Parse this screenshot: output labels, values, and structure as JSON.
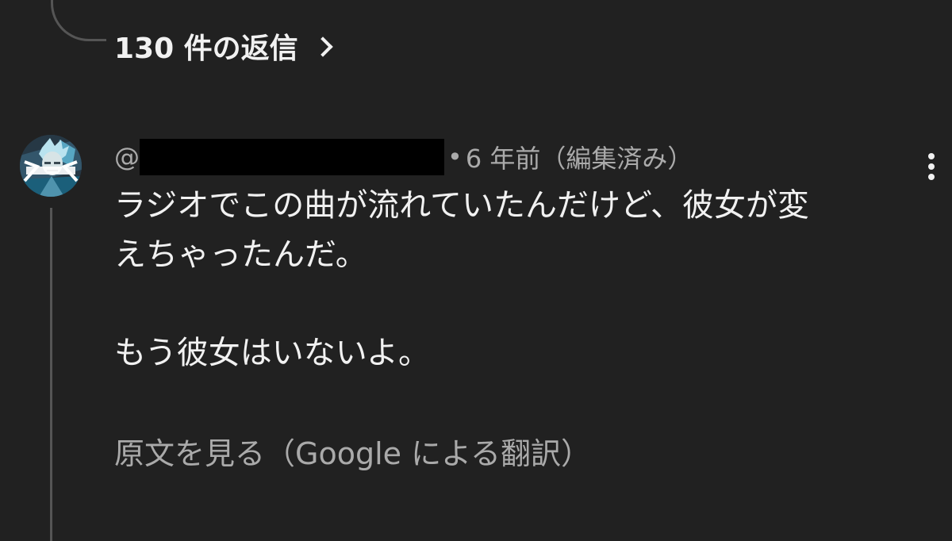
{
  "thread": {
    "replies_label": "130 件の返信"
  },
  "comment": {
    "author_prefix": "@",
    "meta_separator": "•",
    "timestamp": "6 年前（編集済み）",
    "text_lines": [
      "ラジオでこの曲が流れていたんだけど、彼女が変",
      "えちゃったんだ。"
    ],
    "text_lines_2": [
      "もう彼女はいないよ。"
    ],
    "translation_label": "原文を見る（Google による翻訳）"
  },
  "icons": {
    "replies_chevron": "chevron-right-icon",
    "more": "more-vertical-icon",
    "avatar": "avatar-image"
  },
  "colors": {
    "background": "#212121",
    "primary_text": "#f1f1f1",
    "secondary_text": "#aaaaaa",
    "thread_line": "#555555",
    "redaction": "#000000"
  }
}
